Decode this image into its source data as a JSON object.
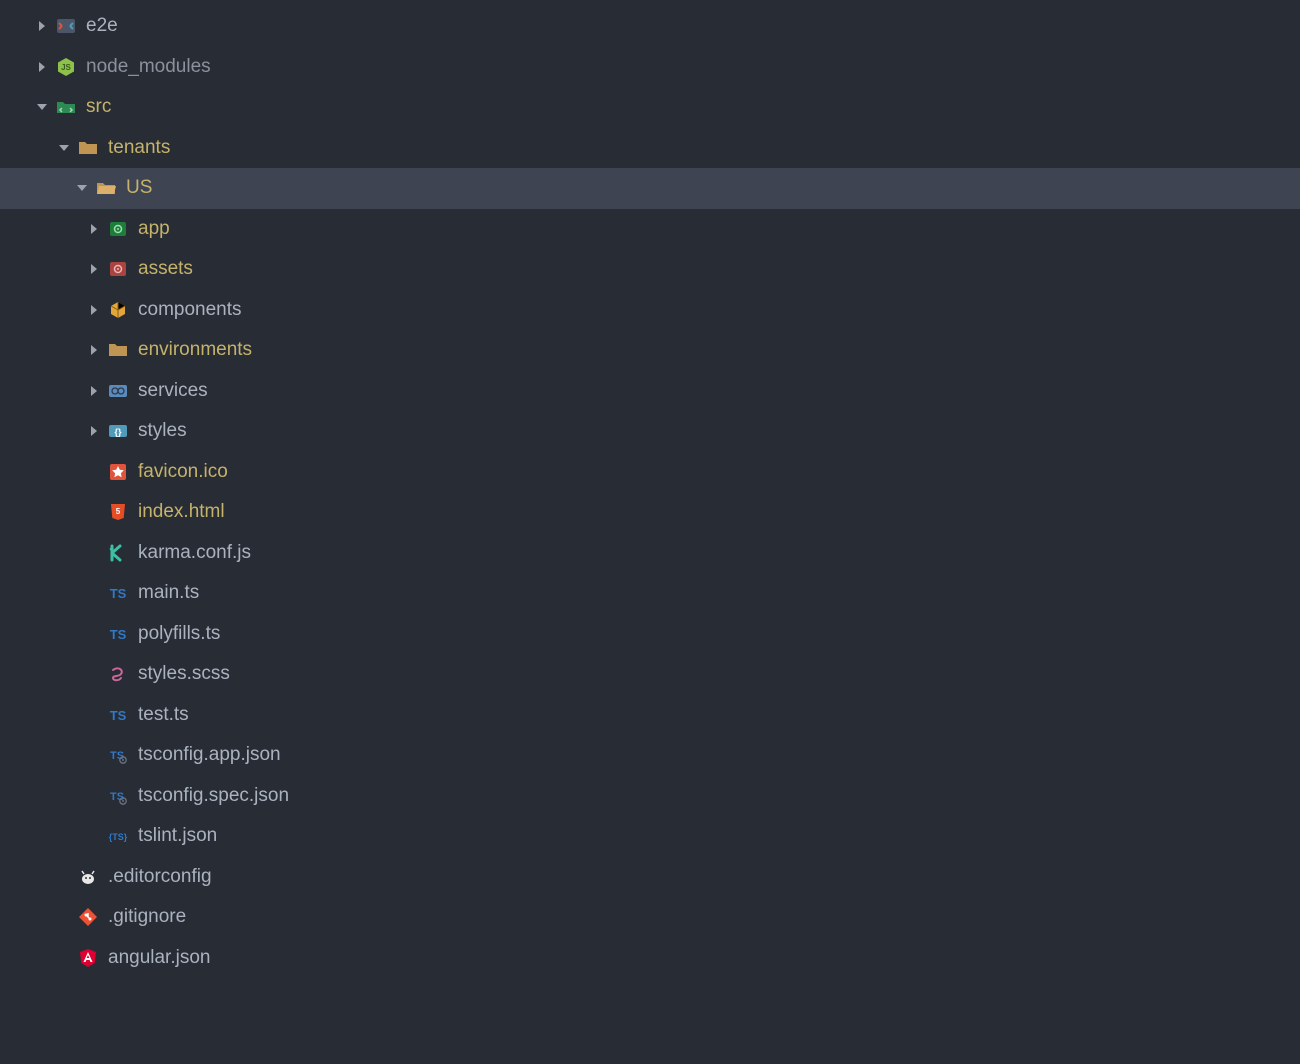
{
  "tree": [
    {
      "depth": 0,
      "arrow": "right",
      "icon": "e2e",
      "label": "e2e",
      "style": "normal"
    },
    {
      "depth": 0,
      "arrow": "right",
      "icon": "node",
      "label": "node_modules",
      "style": "dimmed"
    },
    {
      "depth": 0,
      "arrow": "down",
      "icon": "src",
      "label": "src",
      "style": "highlight"
    },
    {
      "depth": 1,
      "arrow": "down",
      "icon": "folder",
      "label": "tenants",
      "style": "highlight"
    },
    {
      "depth": 2,
      "arrow": "down",
      "icon": "folder-open",
      "label": "US",
      "style": "highlight",
      "selected": true
    },
    {
      "depth": 3,
      "arrow": "right",
      "icon": "app",
      "label": "app",
      "style": "highlight"
    },
    {
      "depth": 3,
      "arrow": "right",
      "icon": "assets",
      "label": "assets",
      "style": "highlight"
    },
    {
      "depth": 3,
      "arrow": "right",
      "icon": "components",
      "label": "components",
      "style": "normal"
    },
    {
      "depth": 3,
      "arrow": "right",
      "icon": "folder",
      "label": "environments",
      "style": "highlight"
    },
    {
      "depth": 3,
      "arrow": "right",
      "icon": "services",
      "label": "services",
      "style": "normal"
    },
    {
      "depth": 3,
      "arrow": "right",
      "icon": "styles",
      "label": "styles",
      "style": "normal"
    },
    {
      "depth": 3,
      "arrow": "none",
      "icon": "favicon",
      "label": "favicon.ico",
      "style": "highlight"
    },
    {
      "depth": 3,
      "arrow": "none",
      "icon": "html",
      "label": "index.html",
      "style": "highlight"
    },
    {
      "depth": 3,
      "arrow": "none",
      "icon": "karma",
      "label": "karma.conf.js",
      "style": "normal"
    },
    {
      "depth": 3,
      "arrow": "none",
      "icon": "ts",
      "label": "main.ts",
      "style": "normal"
    },
    {
      "depth": 3,
      "arrow": "none",
      "icon": "ts",
      "label": "polyfills.ts",
      "style": "normal"
    },
    {
      "depth": 3,
      "arrow": "none",
      "icon": "scss",
      "label": "styles.scss",
      "style": "normal"
    },
    {
      "depth": 3,
      "arrow": "none",
      "icon": "ts",
      "label": "test.ts",
      "style": "normal"
    },
    {
      "depth": 3,
      "arrow": "none",
      "icon": "tsconf",
      "label": "tsconfig.app.json",
      "style": "normal"
    },
    {
      "depth": 3,
      "arrow": "none",
      "icon": "tsconf",
      "label": "tsconfig.spec.json",
      "style": "normal"
    },
    {
      "depth": 3,
      "arrow": "none",
      "icon": "tslint",
      "label": "tslint.json",
      "style": "normal"
    },
    {
      "depth": 1,
      "arrow": "none",
      "icon": "editorconfig",
      "label": ".editorconfig",
      "style": "normal"
    },
    {
      "depth": 1,
      "arrow": "none",
      "icon": "git",
      "label": ".gitignore",
      "style": "normal"
    },
    {
      "depth": 1,
      "arrow": "none",
      "icon": "angular",
      "label": "angular.json",
      "style": "normal"
    }
  ]
}
